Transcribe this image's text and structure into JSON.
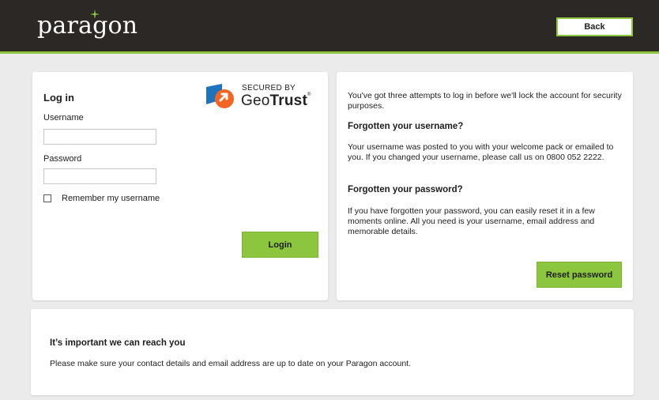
{
  "header": {
    "logo_text": "paragon",
    "back_label": "Back",
    "accent_color": "#8cc63f",
    "background_color": "#2c2826"
  },
  "login": {
    "title": "Log in",
    "username_label": "Username",
    "username_value": "",
    "password_label": "Password",
    "password_value": "",
    "remember_label": "Remember my username",
    "remember_checked": false,
    "login_button": "Login",
    "seal": {
      "secured_by": "SECURED BY",
      "brand_part1": "Geo",
      "brand_part2": "Trust",
      "trademark": "®"
    }
  },
  "help": {
    "attempts_text": "You've got three attempts to log in before we'll lock the account for security purposes.",
    "forgot_username_heading": "Forgotten your username?",
    "forgot_username_text": "Your username was posted to you with your welcome pack or emailed to you. If you changed your username, please call us on 0800 052 2222.",
    "forgot_password_heading": "Forgotten your password?",
    "forgot_password_text": "If you have forgotten your password, you can easily reset it in a few moments online. All you need is your username, email address and memorable details.",
    "reset_button": "Reset password"
  },
  "reach": {
    "title": "It’s important we can reach you",
    "text": "Please make sure your contact details and email address are up to date on your Paragon account."
  }
}
